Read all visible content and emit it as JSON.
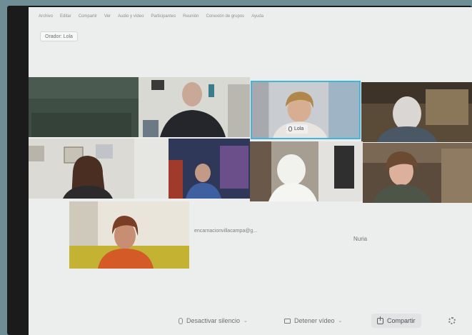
{
  "menu": {
    "items": [
      "Archivo",
      "Editar",
      "Compartir",
      "Ver",
      "Audio y vídeo",
      "Participantes",
      "Reunión",
      "Conexión de grupos",
      "Ayuda"
    ]
  },
  "presenter_chip": {
    "label": "Orador: Lola"
  },
  "participants": {
    "active_name": "Lola",
    "email_tile_text": "encarnacionvillacampa@g...",
    "name_tile_text": "Nuria"
  },
  "controls": {
    "mute_label": "Desactivar silencio",
    "video_label": "Detener vídeo",
    "share_label": "Compartir"
  },
  "colors": {
    "active_speaker_border": "#43b5dc",
    "screen_bg": "#eceeee"
  }
}
